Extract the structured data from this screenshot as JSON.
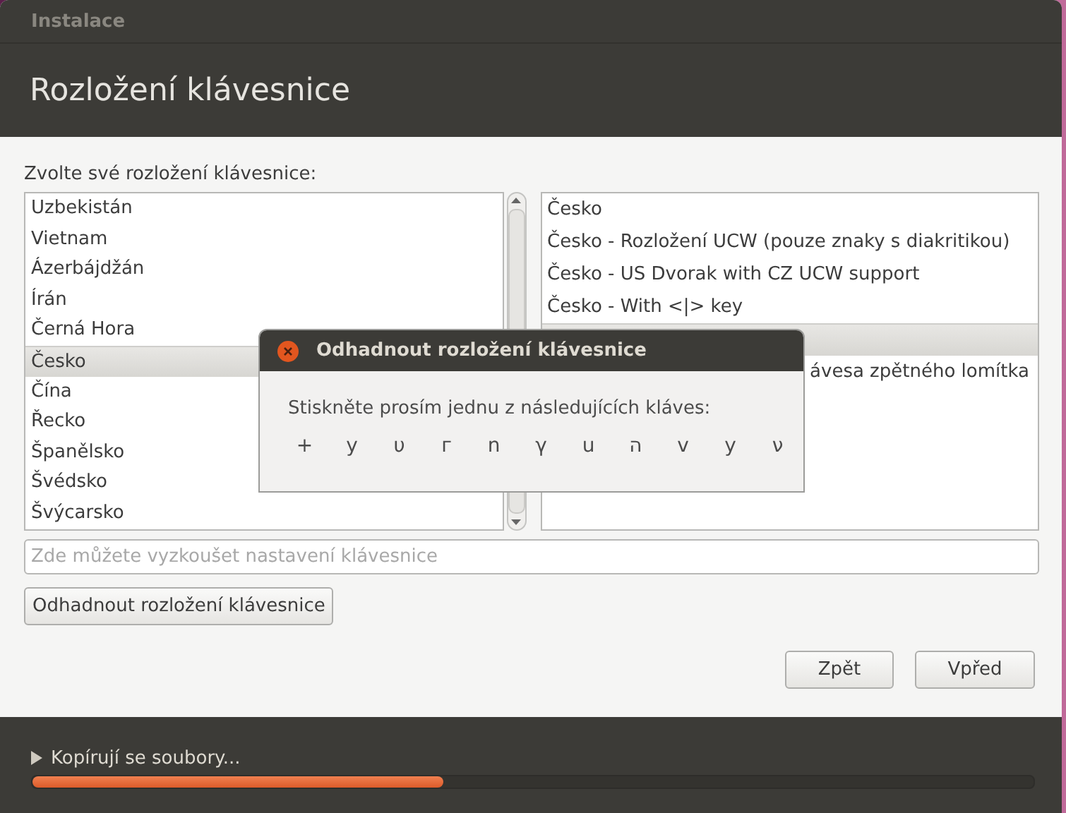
{
  "window": {
    "title": "Instalace"
  },
  "header": {
    "title": "Rozložení klávesnice"
  },
  "prompt": "Zvolte své rozložení klávesnice:",
  "layouts": [
    {
      "label": "Uzbekistán",
      "selected": false
    },
    {
      "label": "Vietnam",
      "selected": false
    },
    {
      "label": "Ázerbájdžán",
      "selected": false
    },
    {
      "label": "Írán",
      "selected": false
    },
    {
      "label": "Černá Hora",
      "selected": false
    },
    {
      "label": "Česko",
      "selected": true
    },
    {
      "label": "Čína",
      "selected": false
    },
    {
      "label": "Řecko",
      "selected": false
    },
    {
      "label": "Španělsko",
      "selected": false
    },
    {
      "label": "Švédsko",
      "selected": false
    },
    {
      "label": "Švýcarsko",
      "selected": false
    }
  ],
  "variants": [
    {
      "label": "Česko",
      "selected": false,
      "covered": false
    },
    {
      "label": "Česko - Rozložení UCW (pouze znaky s diakritikou)",
      "selected": false,
      "covered": false
    },
    {
      "label": "Česko - US Dvorak with CZ UCW support",
      "selected": false,
      "covered": false
    },
    {
      "label": "Česko - With <|> key",
      "selected": false,
      "covered": false
    },
    {
      "selected": true,
      "covered": true
    },
    {
      "label": "ávesa zpětného lomítka",
      "selected": false,
      "covered": true
    }
  ],
  "test_field": {
    "placeholder": "Zde můžete vyzkoušet nastavení klávesnice"
  },
  "detect_button": "Odhadnout rozložení klávesnice",
  "buttons": [
    "Zpět",
    "Vpřed"
  ],
  "dialog": {
    "title": "Odhadnout rozložení klávesnice",
    "message": "Stiskněte prosím jednu z následujících kláves:",
    "keys": [
      "+",
      "y",
      "υ",
      "г",
      "n",
      "γ",
      "u",
      "ה",
      "v",
      "у",
      "ν"
    ]
  },
  "status": {
    "label": "Kopírují se soubory...",
    "level": 0.41
  }
}
